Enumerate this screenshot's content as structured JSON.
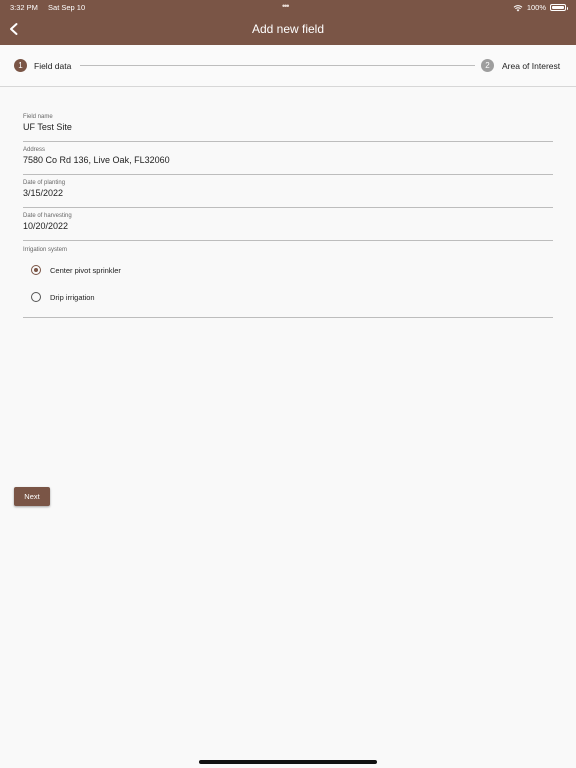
{
  "status_bar": {
    "time": "3:32 PM",
    "date": "Sat Sep 10",
    "battery": "100%",
    "dots": "•••"
  },
  "header": {
    "title": "Add new field",
    "back_icon": "chevron-left-icon"
  },
  "stepper": {
    "steps": [
      {
        "number": "1",
        "label": "Field data",
        "active": true
      },
      {
        "number": "2",
        "label": "Area of Interest",
        "active": false
      }
    ]
  },
  "form": {
    "fields": [
      {
        "label": "Field name",
        "value": "UF Test Site"
      },
      {
        "label": "Address",
        "value": "7580 Co Rd 136, Live Oak, FL32060"
      },
      {
        "label": "Date of planting",
        "value": "3/15/2022"
      },
      {
        "label": "Date of harvesting",
        "value": "10/20/2022"
      }
    ],
    "irrigation": {
      "label": "Irrigation system",
      "options": [
        {
          "label": "Center pivot sprinkler",
          "selected": true
        },
        {
          "label": "Drip irrigation",
          "selected": false
        }
      ]
    }
  },
  "actions": {
    "next_label": "Next"
  },
  "colors": {
    "brand": "#7a5546",
    "inactive_step": "#9e9e9e",
    "background": "#f9f9f9"
  }
}
